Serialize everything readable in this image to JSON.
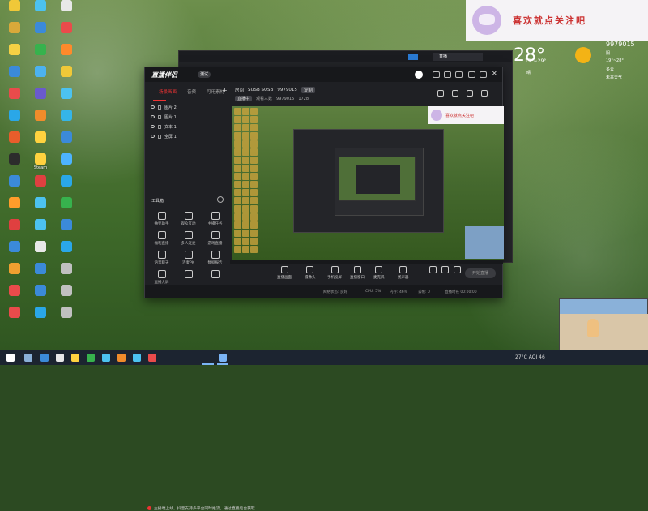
{
  "desktop": {
    "icon_colors": [
      "#f0c838",
      "#4cc2f0",
      "#e8e8e8",
      "#d9a93a",
      "#3b8ad9",
      "#ea4b4b",
      "#f5d144",
      "#37b24d",
      "#ff8a2b",
      "#3b8ad9",
      "#4cb2f0",
      "#f0c838",
      "#ea4b4b",
      "#6a5acd",
      "#4cc2f0",
      "#2aa7e8",
      "#f08c2b",
      "#35b5e8",
      "#e85d2b",
      "#ffd23f",
      "#3b8ad9",
      "#2c2c2c",
      "#ffd23f",
      "#4db3ff",
      "#3b8ad9",
      "#e04040",
      "#2aa7e8",
      "#ff9d2b",
      "#4cc2f0",
      "#37b24d",
      "#e04040",
      "#4cc2f0",
      "#3b8ad9",
      "#3b8ad9",
      "#e8e8e8",
      "#2aa7e8",
      "#f0a030",
      "#3b8ad9",
      "#c0c0c0",
      "#ea4b4b",
      "#3b8ad9",
      "#c0c0c0",
      "#ea4b4b",
      "#2aa7e8",
      "#c0c0c0"
    ],
    "labels": [
      "",
      "",
      "",
      "",
      "",
      "",
      "",
      "",
      "",
      "",
      "",
      "",
      "",
      "",
      "",
      "",
      "",
      "",
      "",
      "",
      "",
      "",
      "Steam",
      "",
      "",
      "",
      "",
      "",
      "",
      "",
      "",
      "",
      "",
      "",
      "",
      "",
      "",
      "",
      "",
      "",
      "",
      "",
      "",
      "",
      ""
    ]
  },
  "banner": {
    "text": "喜欢就点关注吧"
  },
  "weather": {
    "temp": "28°",
    "range": "19°~29°",
    "desc": "晴",
    "right1": "9979015",
    "right2": "阴",
    "right3": "19°~28°",
    "right4": "多云",
    "right5": "未来天气"
  },
  "background_window": {
    "live_label": "直播"
  },
  "app": {
    "logo": "直播伴侣",
    "badge": "测试",
    "sidebar": {
      "tabs": [
        "场景画面",
        "音频",
        "可用素材"
      ],
      "layers": [
        "图片 2",
        "图片 1",
        "文本 1",
        "全屏 1"
      ],
      "tools_title": "工具箱",
      "tools": [
        "抽奖助手",
        "观众互动",
        "主播任务",
        "福利直播",
        "多人连麦",
        "游戏直播",
        "语音聊天",
        "连麦PK",
        "数据报告",
        "直播大屏",
        "",
        ""
      ],
      "notice": "主播端上线，抖音支持多平台同时推流，通过直播后台获取"
    },
    "content": {
      "room_label": "房间",
      "room_name": "SUSB SUSB",
      "room_id": "9979015",
      "room_button": "复制",
      "line2_tag": "直播中",
      "line2_a": "观看人数",
      "line2_b": "9979015",
      "line2_c": "1728",
      "preview_banner": "喜欢就点关注吧",
      "controls": [
        "直播画面",
        "摄像头",
        "手机投屏",
        "直播窗口",
        "麦克风",
        "扬声器"
      ],
      "start_button": "开始直播"
    },
    "status": {
      "items": [
        "网络状态: 良好",
        "CPU: 5%",
        "内存: 46%",
        "丢帧: 0",
        "直播时长 00:00:00"
      ]
    }
  },
  "taskbar": {
    "weather": "27°C AQI 46",
    "icon_colors": [
      "#ffffff",
      "#8ab0d8",
      "#3b8ad9",
      "#e8e8e8",
      "#ffd23f",
      "#37b24d",
      "#4cc2f0",
      "#f08c2b",
      "#4cc2f0",
      "#ea4b4b",
      "#7ab4f5"
    ]
  }
}
